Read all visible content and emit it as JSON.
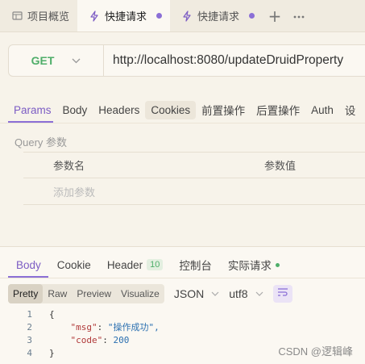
{
  "tabs": [
    {
      "label": "项目概览",
      "icon": "table-icon",
      "active": false
    },
    {
      "label": "快捷请求",
      "icon": "lightning-icon",
      "active": true,
      "unsaved": true
    },
    {
      "label": "快捷请求",
      "icon": "lightning-icon",
      "active": false,
      "unsaved": true
    }
  ],
  "tab_add_label": "+",
  "request": {
    "method": "GET",
    "url": "http://localhost:8080/updateDruidProperty"
  },
  "request_tabs": [
    "Params",
    "Body",
    "Headers",
    "Cookies",
    "前置操作",
    "后置操作",
    "Auth",
    "设"
  ],
  "query": {
    "label": "Query 参数",
    "col_name": "参数名",
    "col_value": "参数值",
    "add_placeholder": "添加参数"
  },
  "response": {
    "tabs": [
      "Body",
      "Cookie",
      "Header",
      "控制台",
      "实际请求"
    ],
    "header_count": "10",
    "format_buttons": [
      "Pretty",
      "Raw",
      "Preview",
      "Visualize"
    ],
    "format_type": "JSON",
    "encoding": "utf8",
    "code_lines": [
      {
        "num": "1",
        "text": "{"
      },
      {
        "num": "2",
        "key": "\"msg\"",
        "value": "\"操作成功\","
      },
      {
        "num": "3",
        "key": "\"code\"",
        "value": "200"
      },
      {
        "num": "4",
        "text": "}"
      }
    ]
  },
  "watermark": "CSDN @逻辑峰",
  "colors": {
    "accent": "#8b6fd6",
    "get": "#4fae6a",
    "background": "#f7f3ea"
  }
}
